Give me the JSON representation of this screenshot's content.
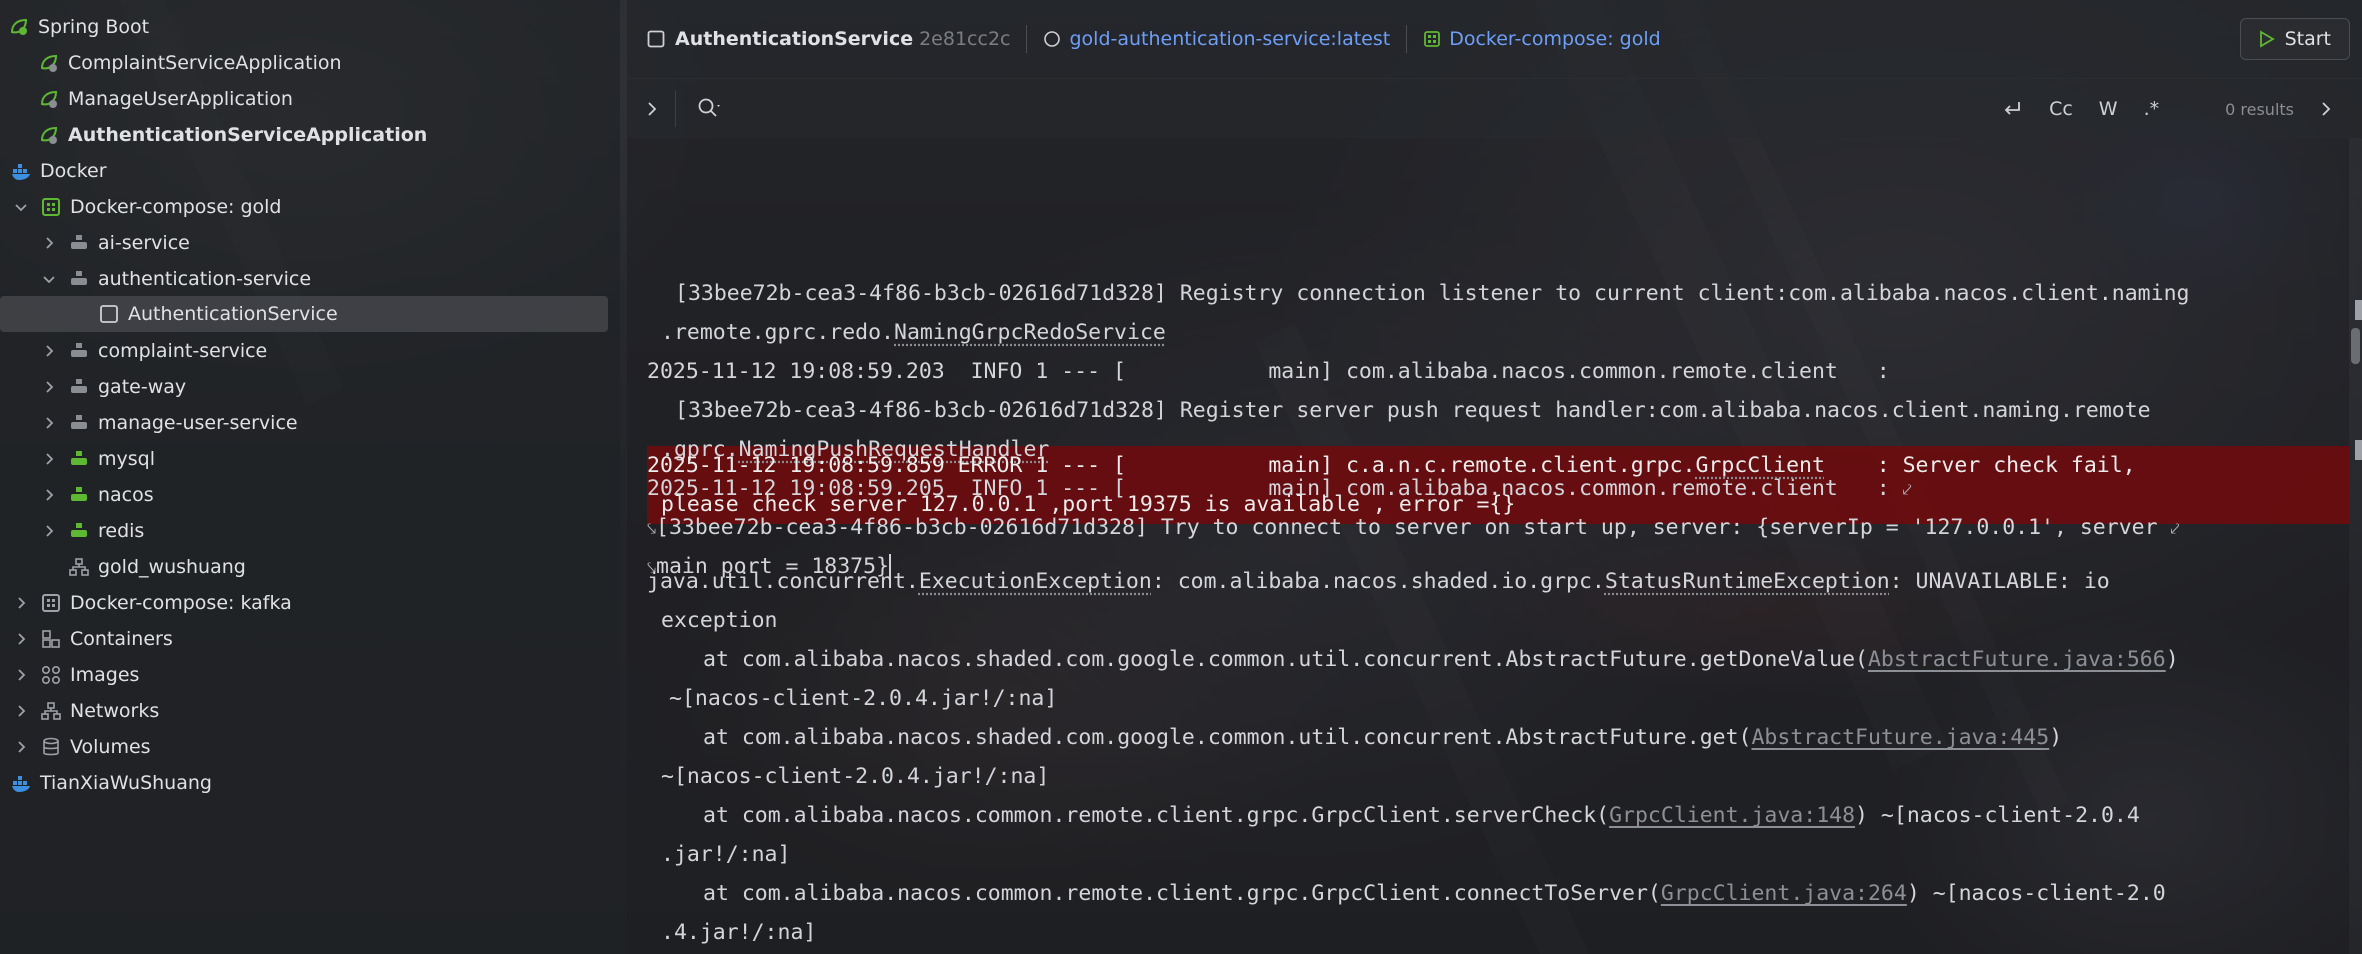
{
  "sidebar": {
    "items": [
      {
        "label": "Spring Boot",
        "icon": "spring-boot-icon",
        "state": "expanded",
        "bold": false
      },
      {
        "label": "ComplaintServiceApplication",
        "icon": "spring-app-icon",
        "bold": false
      },
      {
        "label": "ManageUserApplication",
        "icon": "spring-app-icon",
        "bold": false
      },
      {
        "label": "AuthenticationServiceApplication",
        "icon": "spring-app-icon",
        "bold": true
      },
      {
        "label": "Docker",
        "icon": "docker-icon",
        "bold": false
      },
      {
        "label": "Docker-compose: gold",
        "icon": "compose-icon",
        "state": "expanded",
        "bold": false
      },
      {
        "label": "ai-service",
        "icon": "service-icon",
        "state": "collapsed"
      },
      {
        "label": "authentication-service",
        "icon": "service-icon",
        "state": "expanded"
      },
      {
        "label": "AuthenticationService",
        "icon": "container-checkbox-icon",
        "selected": true
      },
      {
        "label": "complaint-service",
        "icon": "service-icon",
        "state": "collapsed"
      },
      {
        "label": "gate-way",
        "icon": "service-icon",
        "state": "collapsed"
      },
      {
        "label": "manage-user-service",
        "icon": "service-icon",
        "state": "collapsed"
      },
      {
        "label": "mysql",
        "icon": "running-service-icon",
        "state": "collapsed"
      },
      {
        "label": "nacos",
        "icon": "running-service-icon",
        "state": "collapsed"
      },
      {
        "label": "redis",
        "icon": "running-service-icon",
        "state": "collapsed"
      },
      {
        "label": "gold_wushuang",
        "icon": "network-icon"
      },
      {
        "label": "Docker-compose: kafka",
        "icon": "compose-icon",
        "state": "collapsed"
      },
      {
        "label": "Containers",
        "icon": "containers-icon",
        "state": "collapsed"
      },
      {
        "label": "Images",
        "icon": "images-icon",
        "state": "collapsed"
      },
      {
        "label": "Networks",
        "icon": "networks-icon",
        "state": "collapsed"
      },
      {
        "label": "Volumes",
        "icon": "volumes-icon",
        "state": "collapsed"
      },
      {
        "label": "TianXiaWuShuang",
        "icon": "docker-icon"
      }
    ]
  },
  "toolbar": {
    "container_name": "AuthenticationService",
    "container_id": "2e81cc2c",
    "image": "gold-authentication-service:latest",
    "compose": "Docker-compose: gold",
    "start_label": "Start"
  },
  "search": {
    "case_label": "Cc",
    "word_label": "W",
    "regex_label": ".*",
    "results": "0 results"
  },
  "console": {
    "lines": {
      "l1": "[33bee72b-cea3-4f86-b3cb-02616d71d328] Registry connection listener to current client:com.alibaba.nacos.client.naming",
      "l2a": ".remote.gprc.redo.",
      "l2b": "NamingGrpcRedoService",
      "l3": "2025-11-12 19:08:59.203  INFO 1 --- [           main] com.alibaba.nacos.common.remote.client   :",
      "l4": "[33bee72b-cea3-4f86-b3cb-02616d71d328] Register server push request handler:com.alibaba.nacos.client.naming.remote",
      "l5a": ".gprc.",
      "l5b": "NamingPushRequestHandler",
      "l6": "2025-11-12 19:08:59.205  INFO 1 --- [           main] com.alibaba.nacos.common.remote.client   :",
      "l7": "[33bee72b-cea3-4f86-b3cb-02616d71d328] Try to connect to server on start up, server: {serverIp = '127.0.0.1', server",
      "l8": "main port = 18375}",
      "l9a": "2025-11-12 19:08:59.859 ERROR 1 --- [           main] c.a.n.c.remote.client.grpc.",
      "l9b": "GrpcClient",
      "l9c": "    : Server check fail,",
      "l10": "please check server 127.0.0.1 ,port 19375 is available , error ={}",
      "l11a": "java.util.concurrent.",
      "l11b": "ExecutionException",
      "l11c": ": com.alibaba.nacos.shaded.io.grpc.",
      "l11d": "StatusRuntimeException",
      "l11e": ": UNAVAILABLE: io",
      "l12": "exception",
      "l13a": "at com.alibaba.nacos.shaded.com.google.common.util.concurrent.AbstractFuture.getDoneValue(",
      "l13b": "AbstractFuture.java:566",
      "l13c": ")",
      "l14": "~[nacos-client-2.0.4.jar!/:na]",
      "l15a": "at com.alibaba.nacos.shaded.com.google.common.util.concurrent.AbstractFuture.get(",
      "l15b": "AbstractFuture.java:445",
      "l15c": ")",
      "l16": "~[nacos-client-2.0.4.jar!/:na]",
      "l17a": "at com.alibaba.nacos.common.remote.client.grpc.GrpcClient.serverCheck(",
      "l17b": "GrpcClient.java:148",
      "l17c": ") ~[nacos-client-2.0.4",
      "l18": ".jar!/:na]",
      "l19a": "at com.alibaba.nacos.common.remote.client.grpc.GrpcClient.connectToServer(",
      "l19b": "GrpcClient.java:264",
      "l19c": ") ~[nacos-client-2.0",
      "l20": ".4.jar!/:na]"
    }
  },
  "colors": {
    "link": "#6e9ff6",
    "error_bg": "#6e0a0c",
    "spring_green": "#5fb832",
    "docker_blue": "#3d8fe0"
  }
}
